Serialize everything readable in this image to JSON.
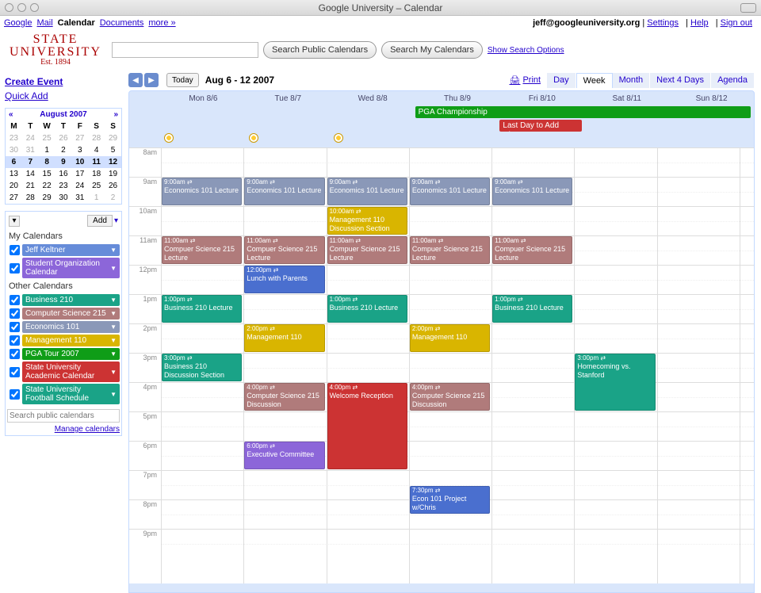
{
  "window": {
    "title": "Google University – Calendar"
  },
  "topnav": {
    "links": [
      "Google",
      "Mail",
      "Calendar",
      "Documents",
      "more »"
    ],
    "active_index": 2,
    "user": "jeff@googleuniversity.org",
    "right_links": [
      "Settings",
      "Help",
      "Sign out"
    ]
  },
  "logo": {
    "line1": "STATE",
    "line2": "UNIVERSITY",
    "line3": "Est. 1894"
  },
  "search": {
    "public_btn": "Search Public Calendars",
    "my_btn": "Search My Calendars",
    "options": "Show Search Options"
  },
  "sidebar": {
    "create_event": "Create Event",
    "quick_add": "Quick Add",
    "minical": {
      "title": "August 2007",
      "daynames": [
        "M",
        "T",
        "W",
        "T",
        "F",
        "S",
        "S"
      ],
      "weeks": [
        {
          "days": [
            23,
            24,
            25,
            26,
            27,
            28,
            29
          ],
          "dim": true
        },
        {
          "days": [
            30,
            31,
            1,
            2,
            3,
            4,
            5
          ],
          "dim_first": 2
        },
        {
          "days": [
            6,
            7,
            8,
            9,
            10,
            11,
            12
          ],
          "current": true
        },
        {
          "days": [
            13,
            14,
            15,
            16,
            17,
            18,
            19
          ]
        },
        {
          "days": [
            20,
            21,
            22,
            23,
            24,
            25,
            26
          ]
        },
        {
          "days": [
            27,
            28,
            29,
            30,
            31,
            1,
            2
          ],
          "dim_last": 2
        }
      ]
    },
    "add_label": "Add",
    "my_calendars_title": "My Calendars",
    "other_calendars_title": "Other Calendars",
    "my_calendars": [
      {
        "name": "Jeff Keltner",
        "color": "#668cd9"
      },
      {
        "name": "Student Organization Calendar",
        "color": "#8c66d9"
      }
    ],
    "other_calendars": [
      {
        "name": "Business 210",
        "color": "#1aa387"
      },
      {
        "name": "Computer Science 215",
        "color": "#b07b7b"
      },
      {
        "name": "Economics 101",
        "color": "#8a98b8"
      },
      {
        "name": "Management 110",
        "color": "#d9b500"
      },
      {
        "name": "PGA Tour 2007",
        "color": "#0f9d17"
      },
      {
        "name": "State University Academic Calendar",
        "color": "#cc3333"
      },
      {
        "name": "State University Football Schedule",
        "color": "#1aa387"
      }
    ],
    "search_placeholder": "Search public calendars",
    "manage": "Manage calendars"
  },
  "controls": {
    "today": "Today",
    "range": "Aug 6 - 12 2007",
    "print": "Print",
    "views": [
      "Day",
      "Week",
      "Month",
      "Next 4 Days",
      "Agenda"
    ],
    "active_view_index": 1
  },
  "grid": {
    "day_headers": [
      "Mon 8/6",
      "Tue 8/7",
      "Wed 8/8",
      "Thu 8/9",
      "Fri 8/10",
      "Sat 8/11",
      "Sun 8/12"
    ],
    "hours": [
      "8am",
      "9am",
      "10am",
      "11am",
      "12pm",
      "1pm",
      "2pm",
      "3pm",
      "4pm",
      "5pm",
      "6pm",
      "7pm",
      "8pm",
      "9pm"
    ],
    "allday_events": [
      {
        "title": "PGA Championship",
        "day_start": 3,
        "day_span": 4,
        "color": "#0f9d17"
      },
      {
        "title": "Last Day to Add Classes",
        "day_start": 4,
        "day_span": 1,
        "row": 1,
        "color": "#cc3333"
      }
    ],
    "weather_days": [
      0,
      1,
      2
    ],
    "events": [
      {
        "day": 0,
        "start": 9,
        "dur": 1,
        "time": "9:00am",
        "title": "Economics 101 Lecture",
        "color": "#8a98b8"
      },
      {
        "day": 1,
        "start": 9,
        "dur": 1,
        "time": "9:00am",
        "title": "Economics 101 Lecture",
        "color": "#8a98b8"
      },
      {
        "day": 2,
        "start": 9,
        "dur": 1,
        "time": "9:00am",
        "title": "Economics 101 Lecture",
        "color": "#8a98b8"
      },
      {
        "day": 3,
        "start": 9,
        "dur": 1,
        "time": "9:00am",
        "title": "Economics 101 Lecture",
        "color": "#8a98b8"
      },
      {
        "day": 4,
        "start": 9,
        "dur": 1,
        "time": "9:00am",
        "title": "Economics 101 Lecture",
        "color": "#8a98b8"
      },
      {
        "day": 2,
        "start": 10,
        "dur": 1,
        "time": "10:00am",
        "title": "Management 110 Discussion Section",
        "color": "#d9b500"
      },
      {
        "day": 0,
        "start": 11,
        "dur": 1,
        "time": "11:00am",
        "title": "Compuer Science 215 Lecture",
        "color": "#b07b7b"
      },
      {
        "day": 1,
        "start": 11,
        "dur": 1,
        "time": "11:00am",
        "title": "Compuer Science 215 Lecture",
        "color": "#b07b7b"
      },
      {
        "day": 2,
        "start": 11,
        "dur": 1,
        "time": "11:00am",
        "title": "Compuer Science 215 Lecture",
        "color": "#b07b7b"
      },
      {
        "day": 3,
        "start": 11,
        "dur": 1,
        "time": "11:00am",
        "title": "Compuer Science 215 Lecture",
        "color": "#b07b7b"
      },
      {
        "day": 4,
        "start": 11,
        "dur": 1,
        "time": "11:00am",
        "title": "Compuer Science 215 Lecture",
        "color": "#b07b7b"
      },
      {
        "day": 1,
        "start": 12,
        "dur": 1,
        "time": "12:00pm",
        "title": "Lunch with Parents",
        "color": "#4a6fcf"
      },
      {
        "day": 0,
        "start": 13,
        "dur": 1,
        "time": "1:00pm",
        "title": "Business 210 Lecture",
        "color": "#1aa387"
      },
      {
        "day": 2,
        "start": 13,
        "dur": 1,
        "time": "1:00pm",
        "title": "Business 210 Lecture",
        "color": "#1aa387"
      },
      {
        "day": 4,
        "start": 13,
        "dur": 1,
        "time": "1:00pm",
        "title": "Business 210 Lecture",
        "color": "#1aa387"
      },
      {
        "day": 1,
        "start": 14,
        "dur": 1,
        "time": "2:00pm",
        "title": "Management 110",
        "color": "#d9b500"
      },
      {
        "day": 3,
        "start": 14,
        "dur": 1,
        "time": "2:00pm",
        "title": "Management 110",
        "color": "#d9b500"
      },
      {
        "day": 0,
        "start": 15,
        "dur": 1,
        "time": "3:00pm",
        "title": "Business 210 Discussion Section",
        "color": "#1aa387"
      },
      {
        "day": 5,
        "start": 15,
        "dur": 2,
        "time": "3:00pm",
        "title": "Homecoming vs. Stanford",
        "color": "#1aa387"
      },
      {
        "day": 1,
        "start": 16,
        "dur": 1,
        "time": "4:00pm",
        "title": "Computer Science 215 Discussion",
        "color": "#b07b7b"
      },
      {
        "day": 2,
        "start": 16,
        "dur": 3,
        "time": "4:00pm",
        "title": "Welcome Reception",
        "color": "#cc3333"
      },
      {
        "day": 3,
        "start": 16,
        "dur": 1,
        "time": "4:00pm",
        "title": "Computer Science 215 Discussion",
        "color": "#b07b7b"
      },
      {
        "day": 1,
        "start": 18,
        "dur": 1,
        "time": "6:00pm",
        "title": "Executive Committee",
        "color": "#8c66d9"
      },
      {
        "day": 3,
        "start": 19.5,
        "dur": 1,
        "time": "7:30pm",
        "title": "Econ 101 Project w/Chris",
        "color": "#4a6fcf"
      }
    ]
  }
}
